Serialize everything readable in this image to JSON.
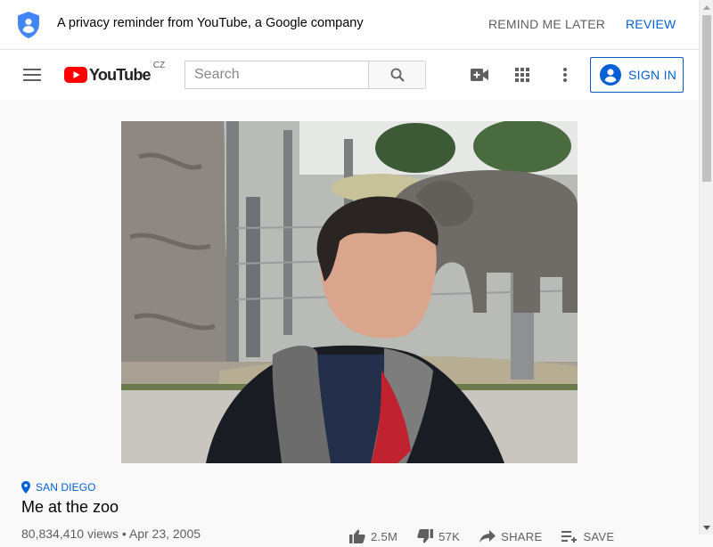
{
  "privacy_banner": {
    "message": "A privacy reminder from YouTube, a Google company",
    "remind_label": "REMIND ME LATER",
    "review_label": "REVIEW"
  },
  "masthead": {
    "logo_text": "YouTube",
    "country_code": "CZ",
    "search_placeholder": "Search",
    "search_value": "",
    "signin_label": "SIGN IN",
    "icons": [
      "menu-icon",
      "youtube-logo-icon",
      "search-icon",
      "create-video-icon",
      "apps-grid-icon",
      "more-vert-icon",
      "account-icon"
    ]
  },
  "video": {
    "location": "SAN DIEGO",
    "title": "Me at the zoo",
    "meta": "80,834,410 views • Apr 23, 2005",
    "actions": [
      {
        "icon": "thumb-up-icon",
        "label": "2.5M"
      },
      {
        "icon": "thumb-down-icon",
        "label": "57K"
      },
      {
        "icon": "share-icon",
        "label": "SHARE"
      },
      {
        "icon": "save-playlist-icon",
        "label": "SAVE"
      }
    ]
  },
  "colors": {
    "accent_blue": "#065fd4",
    "youtube_red": "#ff0000",
    "text_secondary": "#606060"
  }
}
